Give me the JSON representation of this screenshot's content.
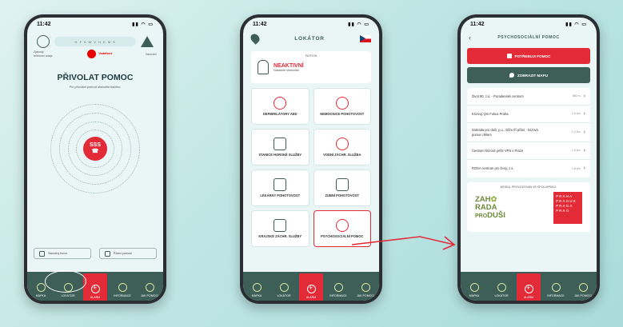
{
  "colors": {
    "brand_dark": "#3e5f58",
    "accent_red": "#e32a37",
    "background": "#bfe6e4"
  },
  "tabs": [
    {
      "label": "MAPKA",
      "icon": "map-icon"
    },
    {
      "label": "LOKÁTOR",
      "icon": "gear-icon"
    },
    {
      "label": "ALARM",
      "icon": "plus-icon"
    },
    {
      "label": "INFORMACE",
      "icon": "info-icon"
    },
    {
      "label": "JAK POMOCI",
      "icon": "people-icon"
    }
  ],
  "phone1": {
    "time": "11:42",
    "code": "G F 5 W V H E M 5",
    "left_caption": "Zjasnuji telefonní údaje",
    "operator_name": "Vodafone",
    "right_caption": "Varování",
    "title": "PŘIVOLAT POMOC",
    "description": "Pro přivolání pomoci stiskněte tlačítko.",
    "sos_label": "SSS",
    "action_left": "Samotný hovor",
    "action_right": "Řízení pomoci"
  },
  "phone2": {
    "time": "11:42",
    "title": "LOKÁTOR",
    "patron_label": "PATRON",
    "patron_status": "NEAKTIVNÍ",
    "patron_sub": "Nastavte sledování",
    "cards": [
      {
        "label": "DEFIBRILÁTORY AED"
      },
      {
        "label": "NEMOCNICE POHOTOVOST"
      },
      {
        "label": "STANICE HORSKÉ SLUŽBY"
      },
      {
        "label": "VODNÍ ZÁCHR. SLUŽBA"
      },
      {
        "label": "LÉKÁRNY POHOTOVOST"
      },
      {
        "label": "ZUBNÍ POHOTOVOST"
      },
      {
        "label": "KRAJSKÉ ZÁCHR. SLUŽBY"
      },
      {
        "label": "PSYCHOSOCIÁLNÍ POMOC"
      }
    ]
  },
  "phone3": {
    "time": "11:42",
    "title": "PSYCHOSOCIÁLNÍ POMOC",
    "need_help": "POTŘEBUJI POMOC",
    "show_map": "ZOBRAZIT MAPU",
    "items": [
      {
        "name": "Život 90, z.ú. - Poradenské centrum",
        "dist": "880 m"
      },
      {
        "name": "Krizový tým Fokus Praha",
        "dist": "1,0 km"
      },
      {
        "name": "Zahrada pro duši, p.o., Dům tří přání - krizová pomoc dětem",
        "dist": "1,2 km"
      },
      {
        "name": "Centrum krizové péče VFN v Praze",
        "dist": "1,5 km"
      },
      {
        "name": "ROSA centrum pro ženy, z.s.",
        "dist": "1,8 km"
      }
    ],
    "partners_label": "MODUL PROVOZOVÁN VE SPOLUPRÁCI:",
    "partner_left": "ZAH RADA DUŠI",
    "partner_right": "PRAHA PRAGUE PRAGA PRAG"
  }
}
